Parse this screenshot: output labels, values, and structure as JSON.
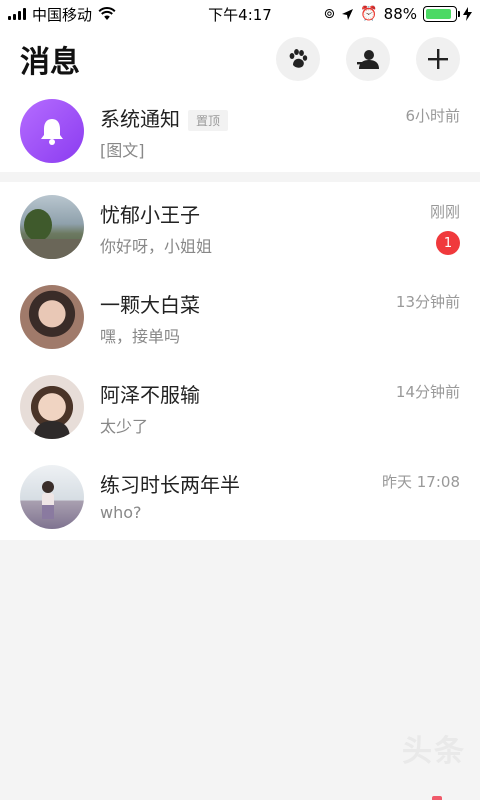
{
  "status_bar": {
    "carrier": "中国移动",
    "time": "下午4:17",
    "battery_percent": "88%",
    "battery_level": 0.88,
    "icons": [
      "signal-icon",
      "wifi-icon",
      "rotation-lock-icon",
      "location-icon",
      "alarm-icon",
      "charging-icon"
    ]
  },
  "header": {
    "title": "消息",
    "actions": [
      "paw-icon",
      "contacts-icon",
      "add-icon"
    ]
  },
  "pinned": {
    "name": "系统通知",
    "tag": "置顶",
    "preview": "[图文]",
    "time": "6小时前",
    "icon": "bell-icon",
    "color": "#a04cf6"
  },
  "conversations": [
    {
      "name": "忧郁小王子",
      "preview": "你好呀，小姐姐",
      "time": "刚刚",
      "unread": "1"
    },
    {
      "name": "一颗大白菜",
      "preview": "嘿，接单吗",
      "time": "13分钟前"
    },
    {
      "name": "阿泽不服输",
      "preview": "太少了",
      "time": "14分钟前"
    },
    {
      "name": "练习时长两年半",
      "preview": "who?",
      "time": "昨天 17:08"
    }
  ],
  "watermark": "头条",
  "colors": {
    "unread_badge": "#f0393c",
    "battery": "#4cd964"
  }
}
